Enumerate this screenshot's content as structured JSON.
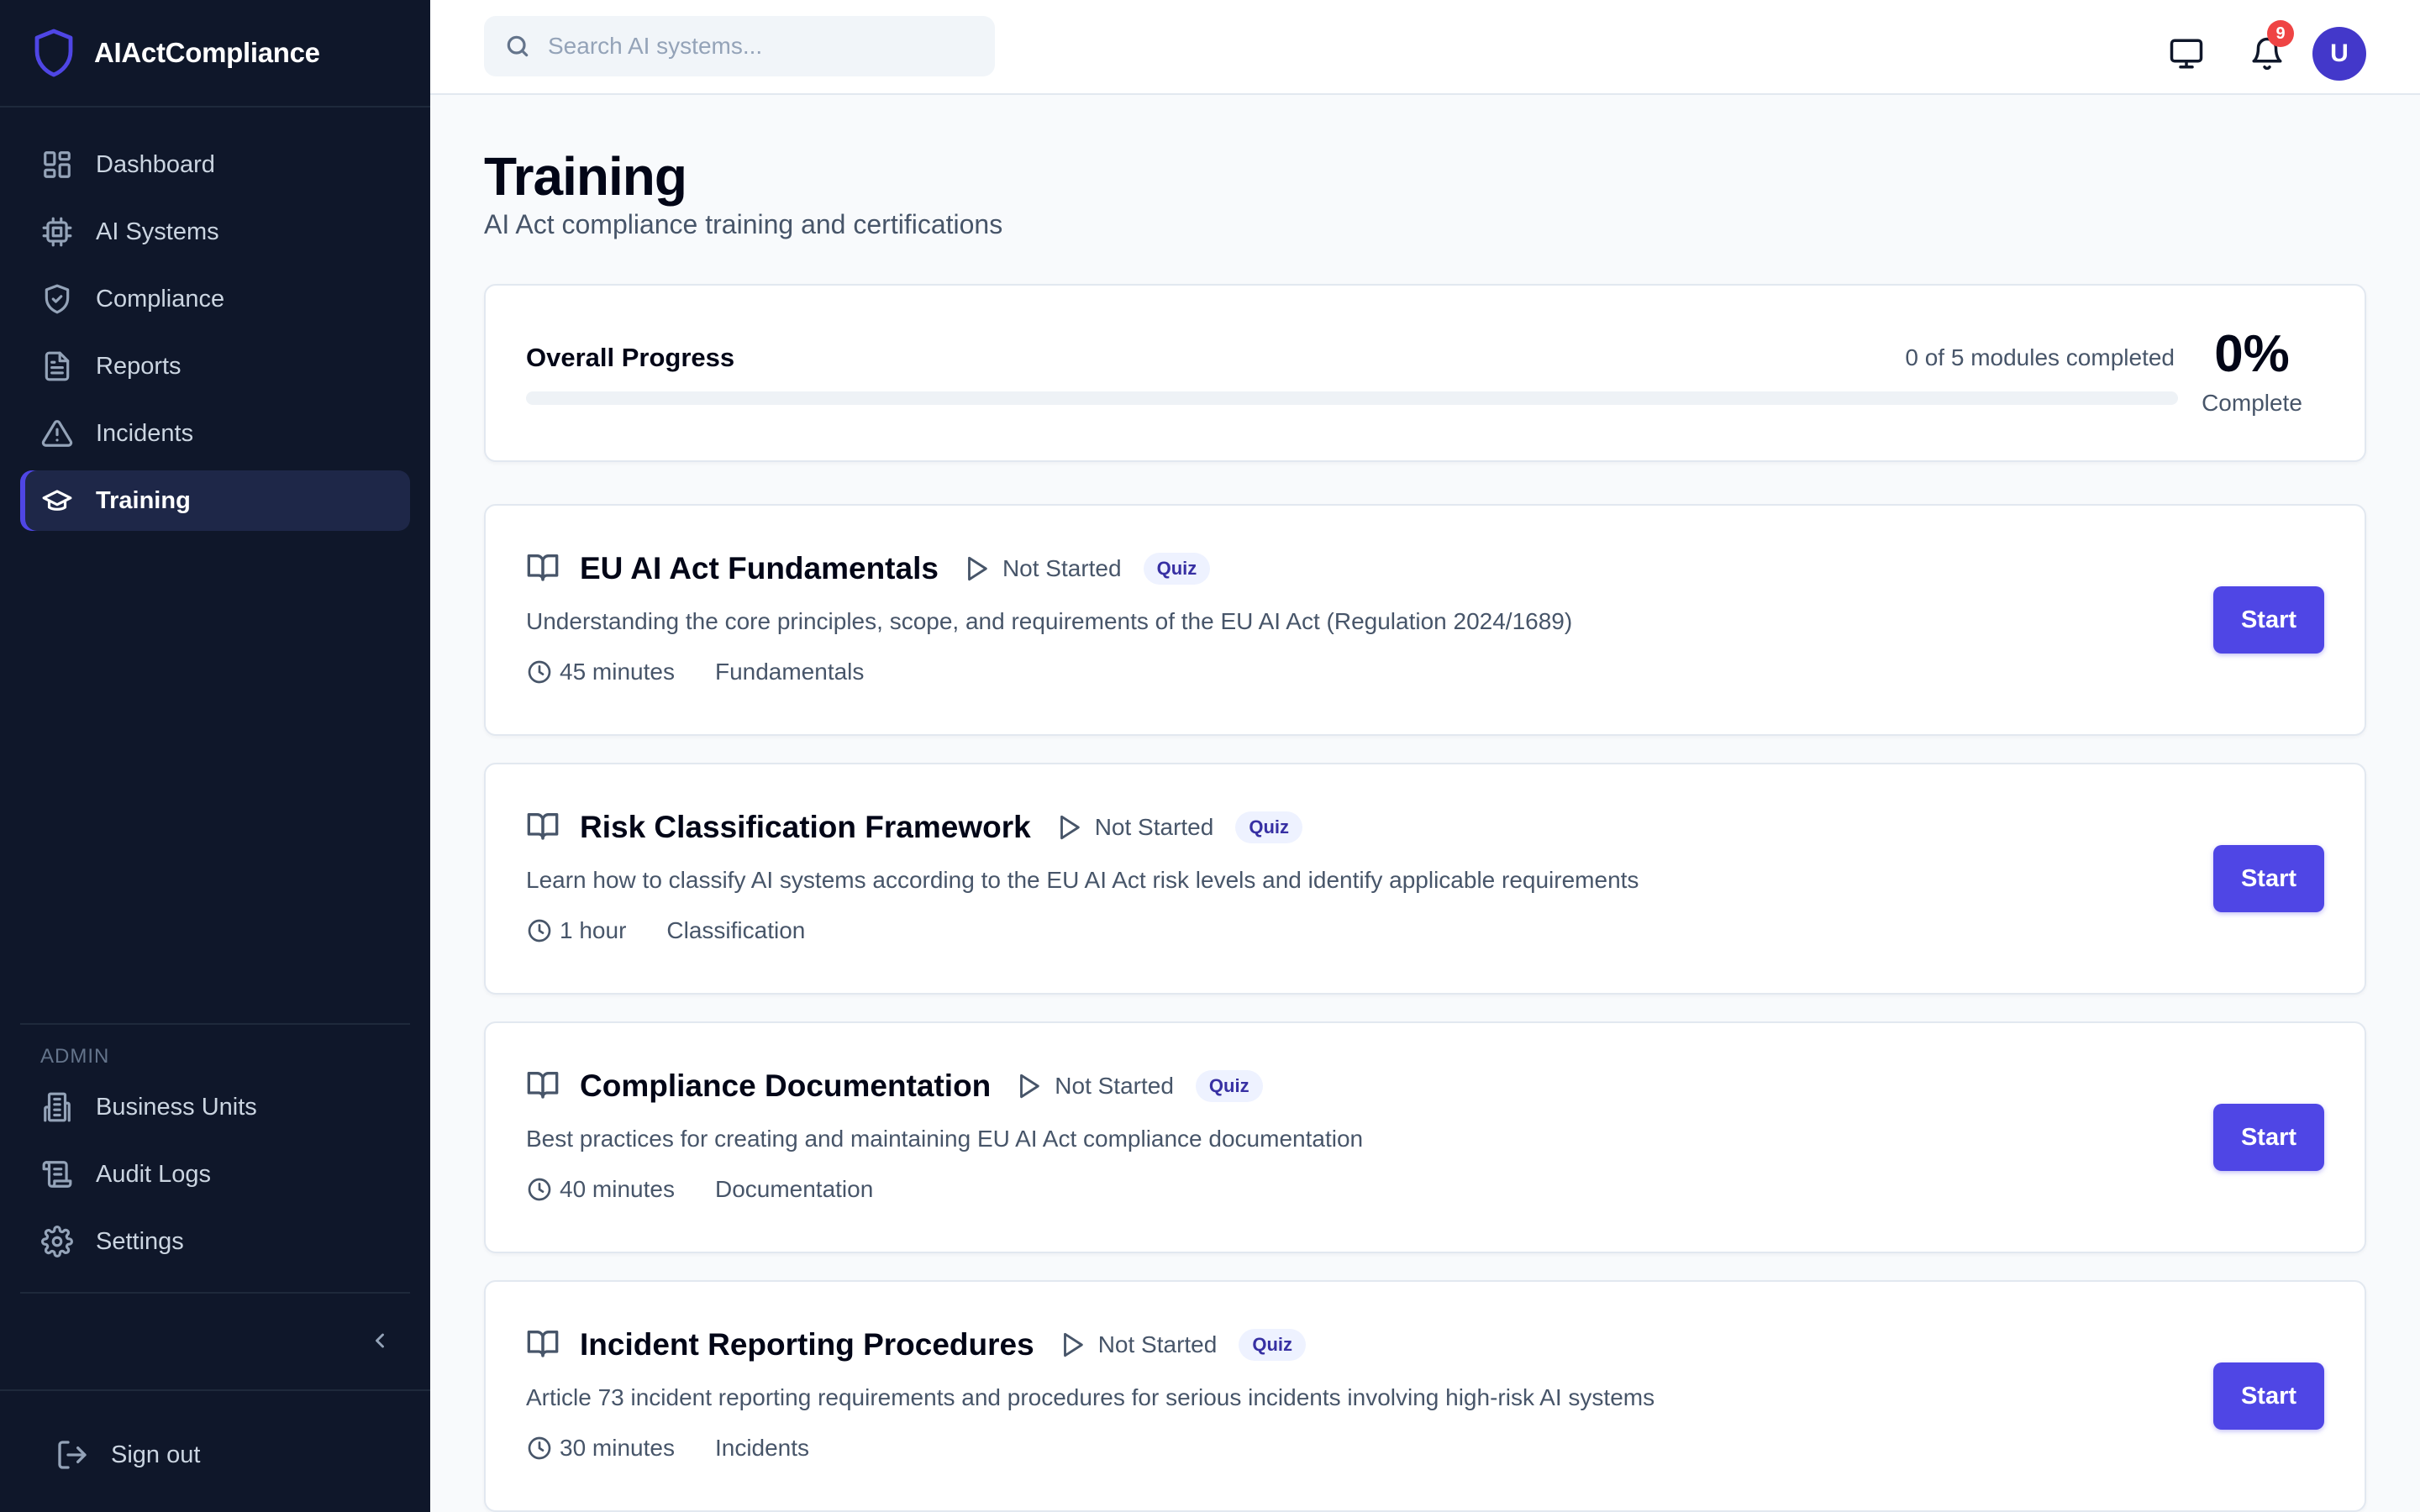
{
  "app": {
    "name": "AIActCompliance"
  },
  "sidebar": {
    "items": [
      {
        "label": "Dashboard",
        "icon": "dashboard-grid-icon"
      },
      {
        "label": "AI Systems",
        "icon": "cpu-chip-icon"
      },
      {
        "label": "Compliance",
        "icon": "shield-check-icon"
      },
      {
        "label": "Reports",
        "icon": "document-icon"
      },
      {
        "label": "Incidents",
        "icon": "warning-triangle-icon"
      },
      {
        "label": "Training",
        "icon": "graduation-cap-icon",
        "active": true
      }
    ],
    "admin_label": "ADMIN",
    "admin_items": [
      {
        "label": "Business Units",
        "icon": "building-icon"
      },
      {
        "label": "Audit Logs",
        "icon": "scroll-icon"
      },
      {
        "label": "Settings",
        "icon": "gear-icon"
      }
    ],
    "signout_label": "Sign out"
  },
  "topbar": {
    "search_placeholder": "Search AI systems...",
    "notification_count": "9",
    "avatar_initial": "U"
  },
  "page": {
    "title": "Training",
    "subtitle": "AI Act compliance training and certifications"
  },
  "progress": {
    "title": "Overall Progress",
    "count_text": "0 of 5 modules completed",
    "percent_text": "0%",
    "percent_label": "Complete",
    "fraction": 0
  },
  "modules": [
    {
      "title": "EU AI Act Fundamentals",
      "status": "Not Started",
      "tag": "Quiz",
      "description": "Understanding the core principles, scope, and requirements of the EU AI Act (Regulation 2024/1689)",
      "duration": "45 minutes",
      "category": "Fundamentals",
      "button": "Start"
    },
    {
      "title": "Risk Classification Framework",
      "status": "Not Started",
      "tag": "Quiz",
      "description": "Learn how to classify AI systems according to the EU AI Act risk levels and identify applicable requirements",
      "duration": "1 hour",
      "category": "Classification",
      "button": "Start"
    },
    {
      "title": "Compliance Documentation",
      "status": "Not Started",
      "tag": "Quiz",
      "description": "Best practices for creating and maintaining EU AI Act compliance documentation",
      "duration": "40 minutes",
      "category": "Documentation",
      "button": "Start"
    },
    {
      "title": "Incident Reporting Procedures",
      "status": "Not Started",
      "tag": "Quiz",
      "description": "Article 73 incident reporting requirements and procedures for serious incidents involving high-risk AI systems",
      "duration": "30 minutes",
      "category": "Incidents",
      "button": "Start"
    }
  ],
  "colors": {
    "sidebar_bg": "#0f172a",
    "accent": "#4f46e5",
    "badge": "#ef4444"
  }
}
